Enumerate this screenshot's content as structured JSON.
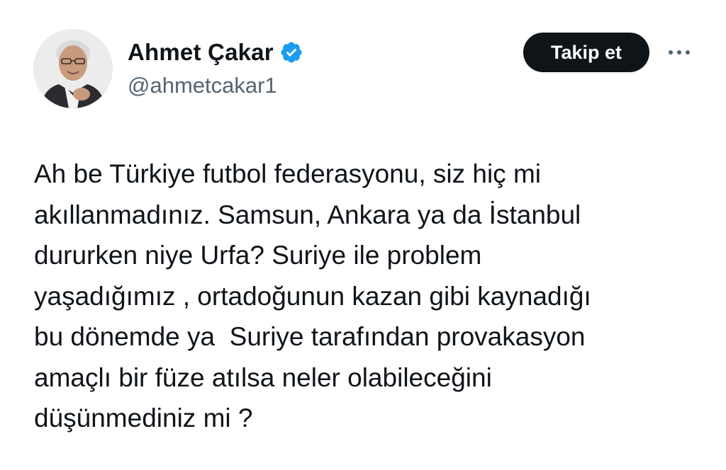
{
  "author": {
    "display_name": "Ahmet Çakar",
    "handle": "@ahmetcakar1",
    "verified_icon": "verified-badge-icon",
    "avatar_icon": "profile-photo"
  },
  "actions": {
    "follow_label": "Takip et",
    "more_icon": "more-options-icon"
  },
  "tweet": {
    "text": "Ah be Türkiye futbol federasyonu, siz hiç mi\nakıllanmadınız. Samsun, Ankara ya da İstanbul\ndururken niye Urfa? Suriye ile problem\nyaşadığımız , ortadoğunun kazan gibi kaynadığı\nbu dönemde ya  Suriye tarafından provakasyon\namaçlı bir füze atılsa neler olabileceğini\ndüşünmediniz mi ?"
  },
  "colors": {
    "text_primary": "#0f1419",
    "text_secondary": "#536471",
    "verified_blue": "#1d9bf0",
    "button_bg": "#0f1419",
    "button_text": "#ffffff"
  }
}
